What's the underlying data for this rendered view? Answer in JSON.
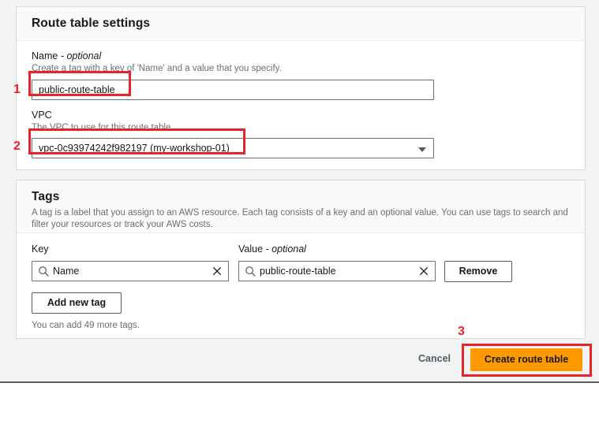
{
  "settings_card": {
    "title": "Route table settings",
    "name_field": {
      "label": "Name",
      "optional_suffix": "- optional",
      "hint": "Create a tag with a key of 'Name' and a value that you specify.",
      "value": "public-route-table",
      "placeholder": ""
    },
    "vpc_field": {
      "label": "VPC",
      "hint": "The VPC to use for this route table.",
      "value": "vpc-0c93974242f982197 (my-workshop-01)",
      "caret_icon": "chevron-down-icon"
    }
  },
  "tags_card": {
    "title": "Tags",
    "description": "A tag is a label that you assign to an AWS resource. Each tag consists of a key and an optional value. You can use tags to search and filter your resources or track your AWS costs.",
    "key_column_label": "Key",
    "value_column_label": "Value",
    "value_optional_suffix": "- optional",
    "rows": [
      {
        "key": "Name",
        "value": "public-route-table",
        "key_icon": "search-icon",
        "value_icon": "search-icon",
        "key_clear_icon": "close-icon",
        "value_clear_icon": "close-icon",
        "remove_label": "Remove"
      }
    ],
    "add_tag_label": "Add new tag",
    "remaining_note": "You can add 49 more tags."
  },
  "footer": {
    "cancel_label": "Cancel",
    "create_label": "Create route table"
  },
  "annotations": [
    {
      "number": "1"
    },
    {
      "number": "2"
    },
    {
      "number": "3"
    }
  ],
  "colors": {
    "primary_button": "#ff9900",
    "annotation_red": "#e8232a",
    "page_background": "#f2f3f3",
    "card_background": "#ffffff",
    "border": "#d5dbdb",
    "text": "#16191f",
    "muted_text": "#687078"
  }
}
